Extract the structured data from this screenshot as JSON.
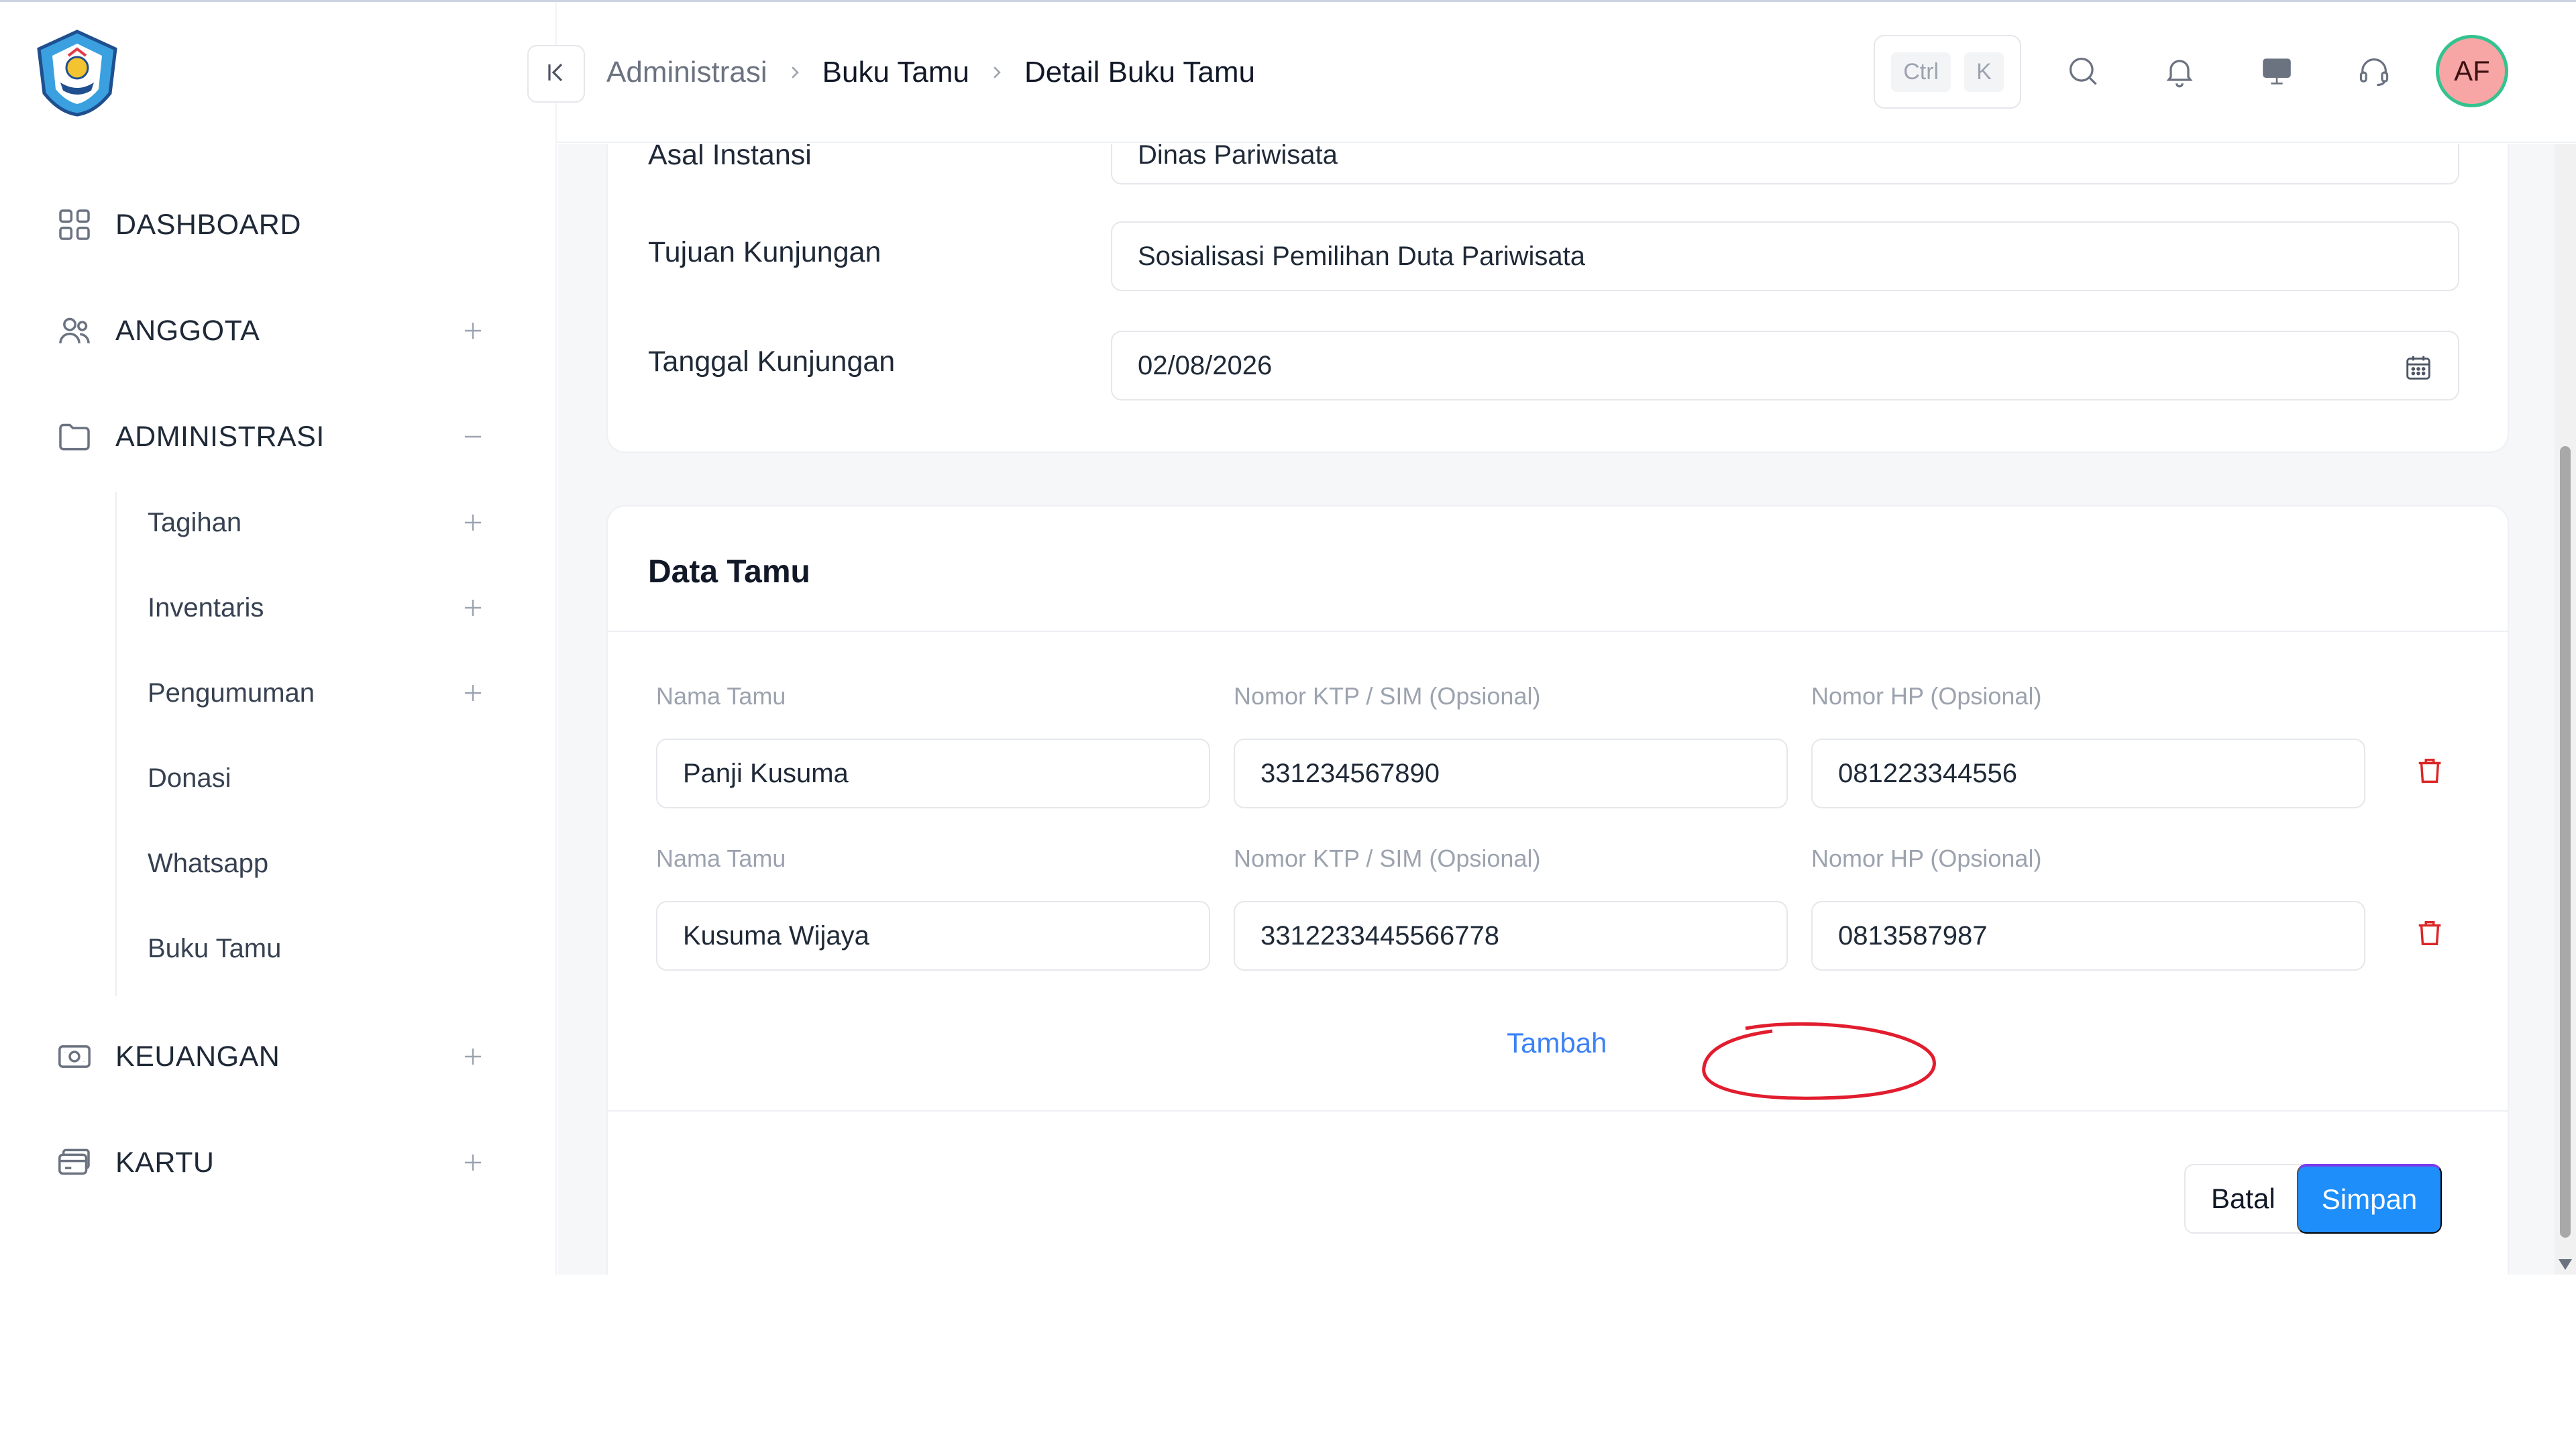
{
  "header": {
    "breadcrumb": [
      "Administrasi",
      "Buku Tamu",
      "Detail Buku Tamu"
    ],
    "shortcut_keys": [
      "Ctrl",
      "K"
    ],
    "avatar_initials": "AF",
    "icons": [
      "collapse-sidebar-icon",
      "search-icon",
      "bell-icon",
      "monitor-icon",
      "headset-icon"
    ]
  },
  "sidebar": {
    "logo": "tut-wuri-handayani-logo",
    "items": [
      {
        "label": "DASHBOARD",
        "icon": "dashboard-grid-icon",
        "toggle": ""
      },
      {
        "label": "ANGGOTA",
        "icon": "users-icon",
        "toggle": "+"
      },
      {
        "label": "ADMINISTRASI",
        "icon": "folder-icon",
        "toggle": "−"
      },
      {
        "label": "KEUANGAN",
        "icon": "money-icon",
        "toggle": "+"
      },
      {
        "label": "KARTU",
        "icon": "card-icon",
        "toggle": "+"
      }
    ],
    "sub_items": [
      {
        "label": "Tagihan",
        "toggle": "+"
      },
      {
        "label": "Inventaris",
        "toggle": "+"
      },
      {
        "label": "Pengumuman",
        "toggle": "+"
      },
      {
        "label": "Donasi",
        "toggle": ""
      },
      {
        "label": "Whatsapp",
        "toggle": ""
      },
      {
        "label": "Buku Tamu",
        "toggle": ""
      }
    ]
  },
  "visit": {
    "institution_label": "Asal Instansi",
    "institution_value": "Dinas Pariwisata",
    "purpose_label": "Tujuan Kunjungan",
    "purpose_value": "Sosialisasi Pemilihan Duta Pariwisata",
    "date_label": "Tanggal Kunjungan",
    "date_value": "02/08/2026"
  },
  "guests": {
    "title": "Data Tamu",
    "col_name": "Nama Tamu",
    "col_id": "Nomor KTP / SIM (Opsional)",
    "col_phone": "Nomor HP (Opsional)",
    "rows": [
      {
        "name": "Panji Kusuma",
        "id": "331234567890",
        "phone": "081223344556"
      },
      {
        "name": "Kusuma Wijaya",
        "id": "3312233445566778",
        "phone": "0813587987"
      }
    ],
    "add_label": "Tambah"
  },
  "actions": {
    "cancel_label": "Batal",
    "save_label": "Simpan"
  },
  "colors": {
    "primary": "#1e8efa",
    "link": "#3b82f6",
    "danger": "#dc2626",
    "annotation": "#e11d2e",
    "avatar_bg": "#f8a5a5",
    "avatar_ring": "#34c38f"
  }
}
